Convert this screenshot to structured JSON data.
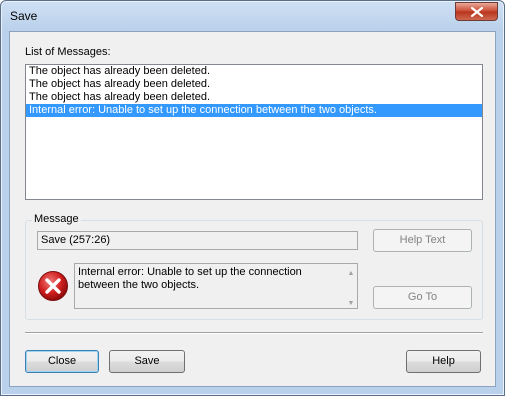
{
  "window": {
    "title": "Save"
  },
  "list": {
    "label": "List of Messages:",
    "items": [
      "The object has already been deleted.",
      "The object has already been deleted.",
      "The object has already been deleted.",
      "Internal error: Unable to set up the connection between the two objects."
    ],
    "selected_index": 3
  },
  "message": {
    "group_label": "Message",
    "source": "Save (257:26)",
    "text": "Internal error: Unable to set up the connection between the two objects.",
    "help_text_button": "Help Text",
    "goto_button": "Go To"
  },
  "buttons": {
    "close": "Close",
    "save": "Save",
    "help": "Help"
  },
  "icons": {
    "window_close": "close-icon",
    "message": "error-icon"
  },
  "colors": {
    "selection": "#3399ff",
    "error": "#c8102e"
  }
}
